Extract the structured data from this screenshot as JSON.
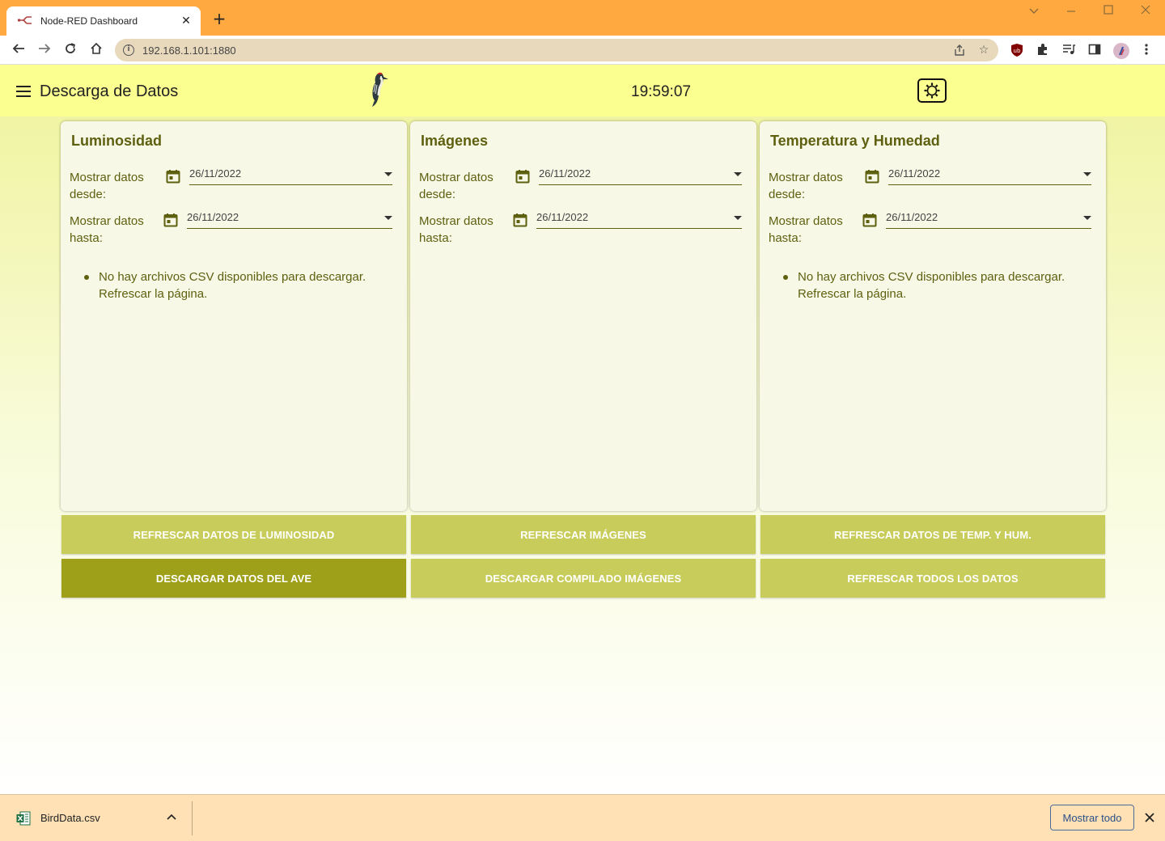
{
  "browser": {
    "tab_title": "Node-RED Dashboard",
    "tab_close": "✕",
    "new_tab": "+",
    "url": "192.168.1.101:1880"
  },
  "dashboard": {
    "title": "Descarga de Datos",
    "clock": "19:59:07"
  },
  "cards": [
    {
      "title": "Luminosidad",
      "from_label": "Mostrar datos desde:",
      "from_value": "26/11/2022",
      "to_label": "Mostrar datos hasta:",
      "to_value": "26/11/2022",
      "message": "No hay archivos CSV disponibles para descargar. Refrescar la página."
    },
    {
      "title": "Imágenes",
      "from_label": "Mostrar datos desde:",
      "from_value": "26/11/2022",
      "to_label": "Mostrar datos hasta:",
      "to_value": "26/11/2022",
      "message": ""
    },
    {
      "title": "Temperatura y Humedad",
      "from_label": "Mostrar datos desde:",
      "from_value": "26/11/2022",
      "to_label": "Mostrar datos hasta:",
      "to_value": "26/11/2022",
      "message": "No hay archivos CSV disponibles para descargar. Refrescar la página."
    }
  ],
  "buttons": {
    "refresh_luminosity": "REFRESCAR DATOS DE LUMINOSIDAD",
    "refresh_images": "REFRESCAR IMÁGENES",
    "refresh_temp_hum": "REFRESCAR DATOS DE TEMP. Y HUM.",
    "download_bird": "DESCARGAR DATOS DEL AVE",
    "download_images": "DESCARGAR COMPILADO IMÁGENES",
    "refresh_all": "REFRESCAR TODOS LOS DATOS"
  },
  "downloads": {
    "file_name": "BirdData.csv",
    "show_all": "Mostrar todo"
  },
  "colors": {
    "toolbar": "#FAFF90",
    "accent_dark": "#9FA01A",
    "accent_light": "#C8CC5A",
    "text_olive": "#5E6010",
    "browser_frame": "#FFA940"
  }
}
